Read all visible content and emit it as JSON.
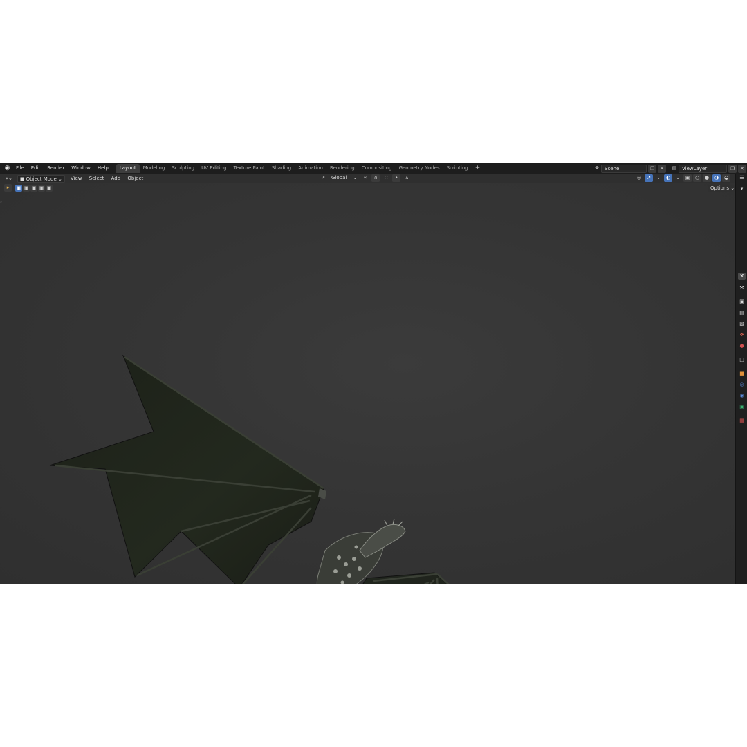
{
  "topbar": {
    "menu": [
      "File",
      "Edit",
      "Render",
      "Window",
      "Help"
    ],
    "workspace_tabs": [
      "Layout",
      "Modeling",
      "Sculpting",
      "UV Editing",
      "Texture Paint",
      "Shading",
      "Animation",
      "Rendering",
      "Compositing",
      "Geometry Nodes",
      "Scripting"
    ],
    "active_tab": "Layout",
    "add_tab_symbol": "+",
    "scene_name": "Scene",
    "view_layer": "ViewLayer"
  },
  "header": {
    "mode": "Object Mode",
    "menus": [
      "View",
      "Select",
      "Add",
      "Object"
    ],
    "transform_orientation": "Global",
    "options_label": "Options"
  },
  "colors": {
    "app_bg": "#2b2b2b",
    "topbar_bg": "#1d1d1d",
    "accent_blue": "#4673b8",
    "wing_membrane": "#1f2419"
  },
  "icons": {
    "logo": "blender-logo-icon",
    "editor_type": "3d-viewport-icon",
    "snap": "magnet-icon",
    "proportional": "proportional-edit-icon",
    "shading": "viewport-shading-icon"
  }
}
